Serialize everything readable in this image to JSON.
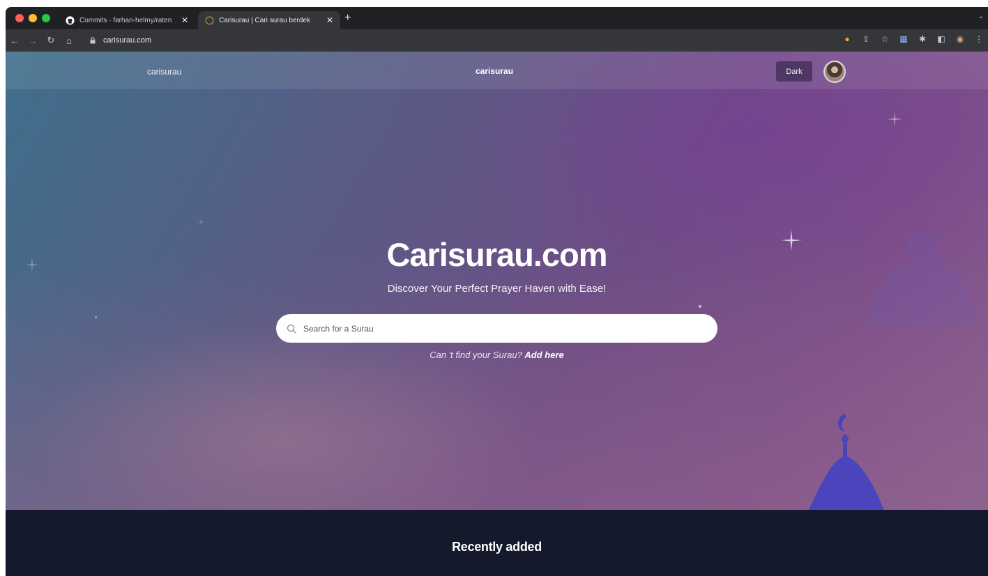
{
  "browser": {
    "tabs": [
      {
        "title": "Commits · farhan-helmy/raten",
        "favicon": "github-icon",
        "active": false
      },
      {
        "title": "Carisurau | Cari surau berdek",
        "favicon": "site-favicon",
        "active": true
      }
    ],
    "new_tab_label": "+",
    "url": "carisurau.com",
    "toolbar_icons": [
      "extension-icon",
      "share-icon",
      "bookmark-star-icon",
      "extension-icon-2",
      "puzzle-icon",
      "sidebar-icon",
      "profile-icon",
      "more-icon"
    ]
  },
  "navbar": {
    "left_brand": "carisurau",
    "center_brand": "carisurau",
    "theme_button": "Dark"
  },
  "hero": {
    "title": "Carisurau.com",
    "subtitle": "Discover Your Perfect Prayer Haven with Ease!",
    "search_placeholder": "Search for a Surau",
    "cant_find_text": "Can 't find your Surau?",
    "add_link": "Add here"
  },
  "recent": {
    "title": "Recently added"
  },
  "colors": {
    "footer_bg": "#141a2b",
    "hero_start": "#3f6f8c",
    "hero_end": "#8a5d90"
  }
}
